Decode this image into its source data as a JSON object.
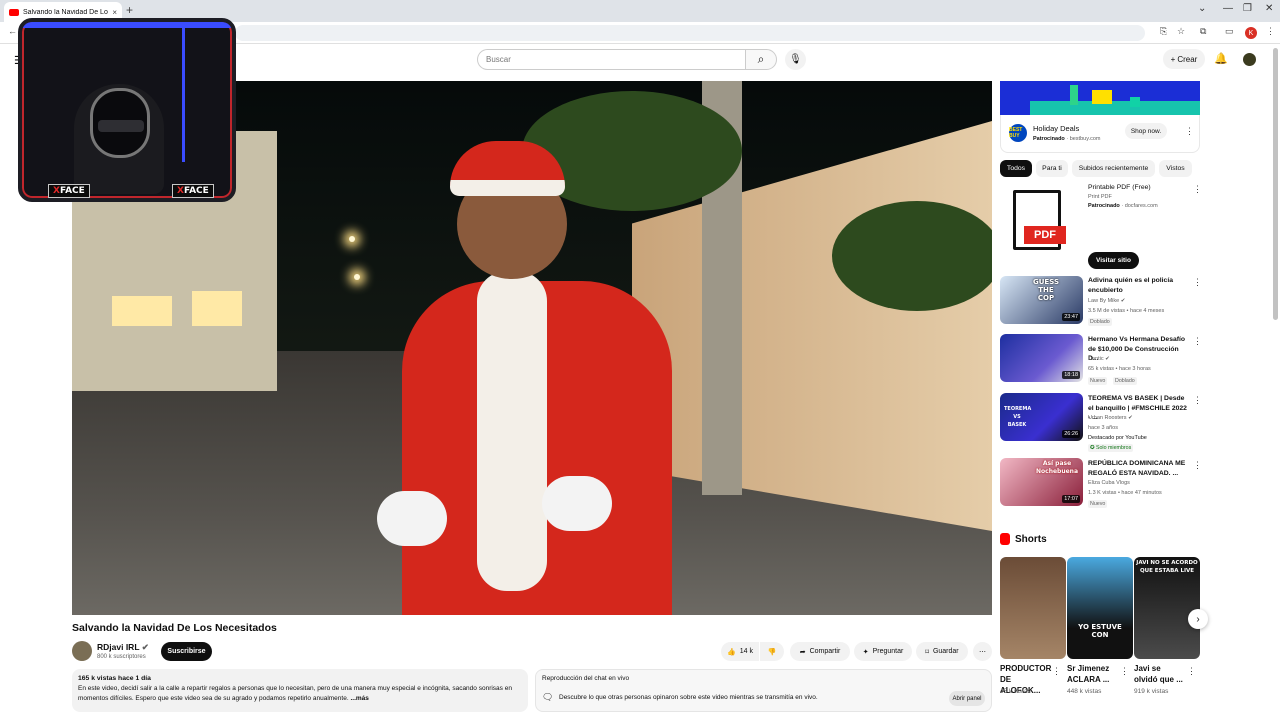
{
  "browser": {
    "tab_title": "Salvando la Navidad De Los Ne",
    "tab_close": "×",
    "new_tab": "+",
    "profile_letter": "K"
  },
  "header": {
    "search_placeholder": "Buscar",
    "create_label": "Crear"
  },
  "webcam": {
    "badge_left": "FACE",
    "badge_right": "FACE",
    "badge_x": "X"
  },
  "video": {
    "title": "Salvando la Navidad De Los Necesitados",
    "channel": "RDjavi IRL",
    "subscribers": "800 k suscriptores",
    "subscribe_label": "Suscribirse",
    "likes": "14 k",
    "share_label": "Compartir",
    "ask_label": "Preguntar",
    "save_label": "Guardar",
    "desc_meta": "165 k vistas  hace 1 día",
    "desc_text": "En este video, decidí salir a la calle a repartir regalos a personas que lo necesitan, pero de una manera muy especial e incógnita, sacando sonrisas en momentos difíciles. Espero que este video sea de su agrado y podamos repetirlo anualmente.",
    "desc_more": "...más"
  },
  "chat": {
    "title": "Reproducción del chat en vivo",
    "text": "Descubre lo que otras personas opinaron sobre este video mientras se transmitía en vivo.",
    "button": "Abrir panel"
  },
  "ad": {
    "name": "Holiday Deals",
    "sponsored": "Patrocinado",
    "domain": "bestbuy.com",
    "cta": "Shop now.",
    "logo_text": "BEST BUY"
  },
  "chips": [
    "Todos",
    "Para ti",
    "Subidos recientemente",
    "Vistos"
  ],
  "promo": {
    "title": "Printable PDF (Free)",
    "sub": "Print PDF",
    "sponsored": "Patrocinado",
    "domain": "docfares.com",
    "pdf_label": "PDF",
    "cta": "Visitar sitio"
  },
  "recommendations": [
    {
      "title": "Adivina quién es el policía encubierto",
      "channel": "Law By Mike",
      "meta": "3.5 M de vistas • hace 4 meses",
      "badge": "Doblado",
      "duration": "23:47",
      "overlay": "GUESS THE COP"
    },
    {
      "title": "Hermano Vs Hermana Desafío de $10,000 De Construcción D...",
      "channel": "Dantic",
      "meta": "65 k vistas • hace 3 horas",
      "badge": "Nuevo",
      "badge2": "Doblado",
      "duration": "18:18"
    },
    {
      "title": "TEOREMA VS BASEK | Desde el banquillo | #FMSCHILE 2022 - ...",
      "channel": "Urban Roosters",
      "meta": "hace 3 años",
      "badge": "Destacado por YouTube",
      "badge2": "Solo miembros",
      "duration": "26:26",
      "overlay": "TEOREMA VS BASEK"
    },
    {
      "title": "REPÚBLICA DOMINICANA ME REGALÓ ESTA NAVIDAD. ...",
      "channel": "Eliza Cuba Vlogs",
      "meta": "1.3 K vistas • hace 47 minutos",
      "badge": "Nuevo",
      "duration": "17:07",
      "overlay": "Así pase Nochebuena"
    }
  ],
  "shorts": {
    "heading": "Shorts",
    "items": [
      {
        "title": "PRODUCTOR DE ALOFOK...",
        "views": "45 k vistas"
      },
      {
        "title": "Sr Jimenez ACLARA ...",
        "views": "448 k vistas",
        "overlay": "YO ESTUVE CON"
      },
      {
        "title": "Javi se olvidó que ...",
        "views": "919 k vistas",
        "overlay": "JAVI NO SE ACORDO QUE ESTABA LIVE"
      }
    ]
  },
  "colors": {
    "accent": "#ff0000",
    "subscribe_bg": "#0f0f0f",
    "ad_banner": "#1b2ed6"
  }
}
